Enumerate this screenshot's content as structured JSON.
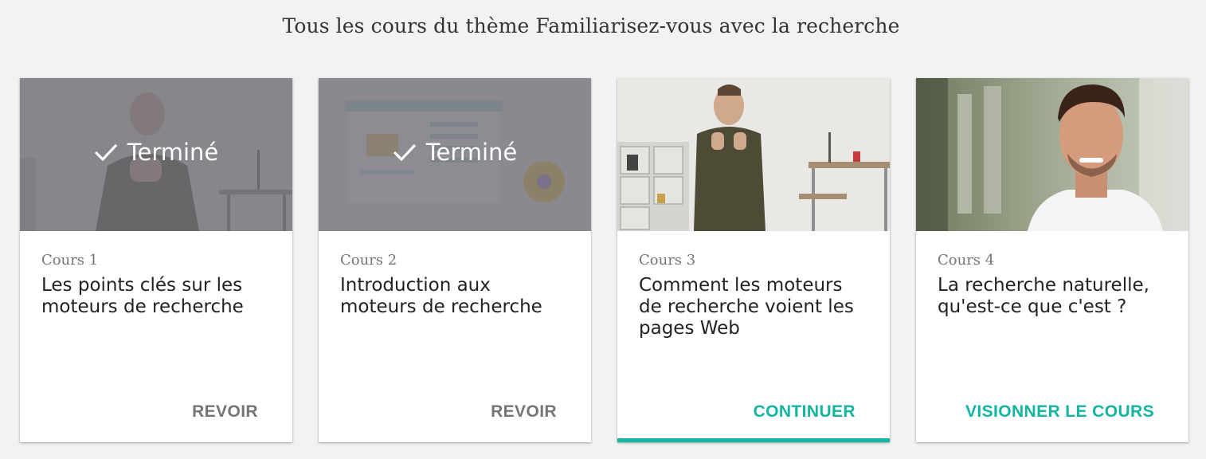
{
  "heading": "Tous les cours du thème Familiarisez-vous avec la recherche",
  "colors": {
    "accent": "#12b5a0",
    "muted": "#757575"
  },
  "cards": [
    {
      "course_num": "Cours 1",
      "title": "Les points clés sur les moteurs de recherche",
      "status": "Terminé",
      "action": "REVOIR",
      "progress": 0
    },
    {
      "course_num": "Cours 2",
      "title": "Introduction aux moteurs de recherche",
      "status": "Terminé",
      "action": "REVOIR",
      "progress": 0
    },
    {
      "course_num": "Cours 3",
      "title": "Comment les moteurs de recherche voient les pages Web",
      "action": "CONTINUER",
      "progress": 1.0
    },
    {
      "course_num": "Cours 4",
      "title": "La recherche naturelle, qu'est-ce que c'est ?",
      "action": "VISIONNER LE COURS",
      "progress": 0
    }
  ]
}
